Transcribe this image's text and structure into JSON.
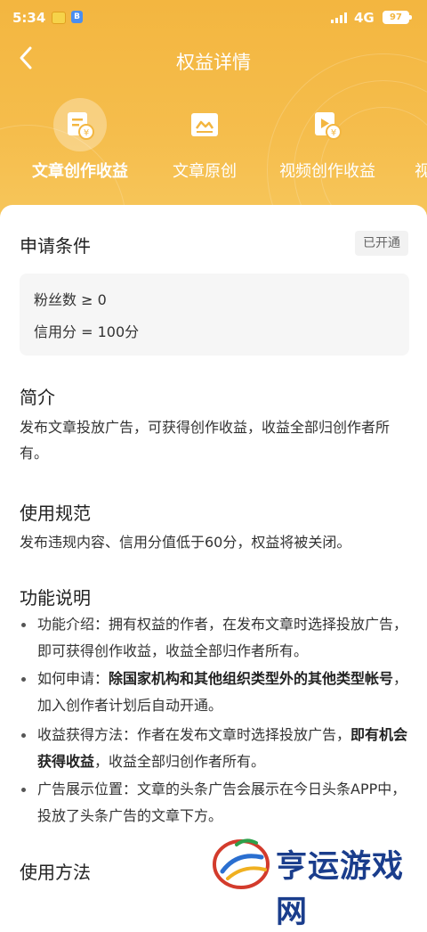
{
  "status_bar": {
    "time": "5:34",
    "app_badge": "B",
    "network": "4G",
    "battery": "97"
  },
  "nav": {
    "back_icon": "chevron-left-icon",
    "title": "权益详情"
  },
  "tabs": [
    {
      "label": "文章创作收益",
      "icon": "article-revenue-icon",
      "active": true
    },
    {
      "label": "文章原创",
      "icon": "article-original-icon",
      "active": false
    },
    {
      "label": "视频创作收益",
      "icon": "video-revenue-icon",
      "active": false
    },
    {
      "label": "视",
      "icon": "",
      "active": false
    }
  ],
  "conditions": {
    "title": "申请条件",
    "status": "已开通",
    "items": [
      "粉丝数 ≥ 0",
      "信用分 = 100分"
    ]
  },
  "intro": {
    "title": "简介",
    "text": "发布文章投放广告，可获得创作收益，收益全部归创作者所有。"
  },
  "rules": {
    "title": "使用规范",
    "text": "发布违规内容、信用分值低于60分，权益将被关闭。"
  },
  "features": {
    "title": "功能说明",
    "items": [
      {
        "label": "功能介绍：",
        "text": "拥有权益的作者，在发布文章时选择投放广告，即可获得创作收益，收益全部归作者所有。"
      },
      {
        "label": "如何申请：",
        "bold": "除国家机构和其他组织类型外的其他类型帐号",
        "text": "，加入创作者计划后自动开通。"
      },
      {
        "label": "收益获得方法：",
        "text": "作者在发布文章时选择投放广告，",
        "bold": "即有机会获得收益",
        "text2": "，收益全部归创作者所有。"
      },
      {
        "label": "广告展示位置：",
        "text": "文章的头条广告会展示在今日头条APP中，投放了头条广告的文章下方。"
      }
    ]
  },
  "usage": {
    "title": "使用方法"
  },
  "watermark": {
    "text": "亨运游戏网"
  },
  "colors": {
    "header": "#f3b640",
    "text": "#333333",
    "watermark": "#1a3d8c"
  }
}
